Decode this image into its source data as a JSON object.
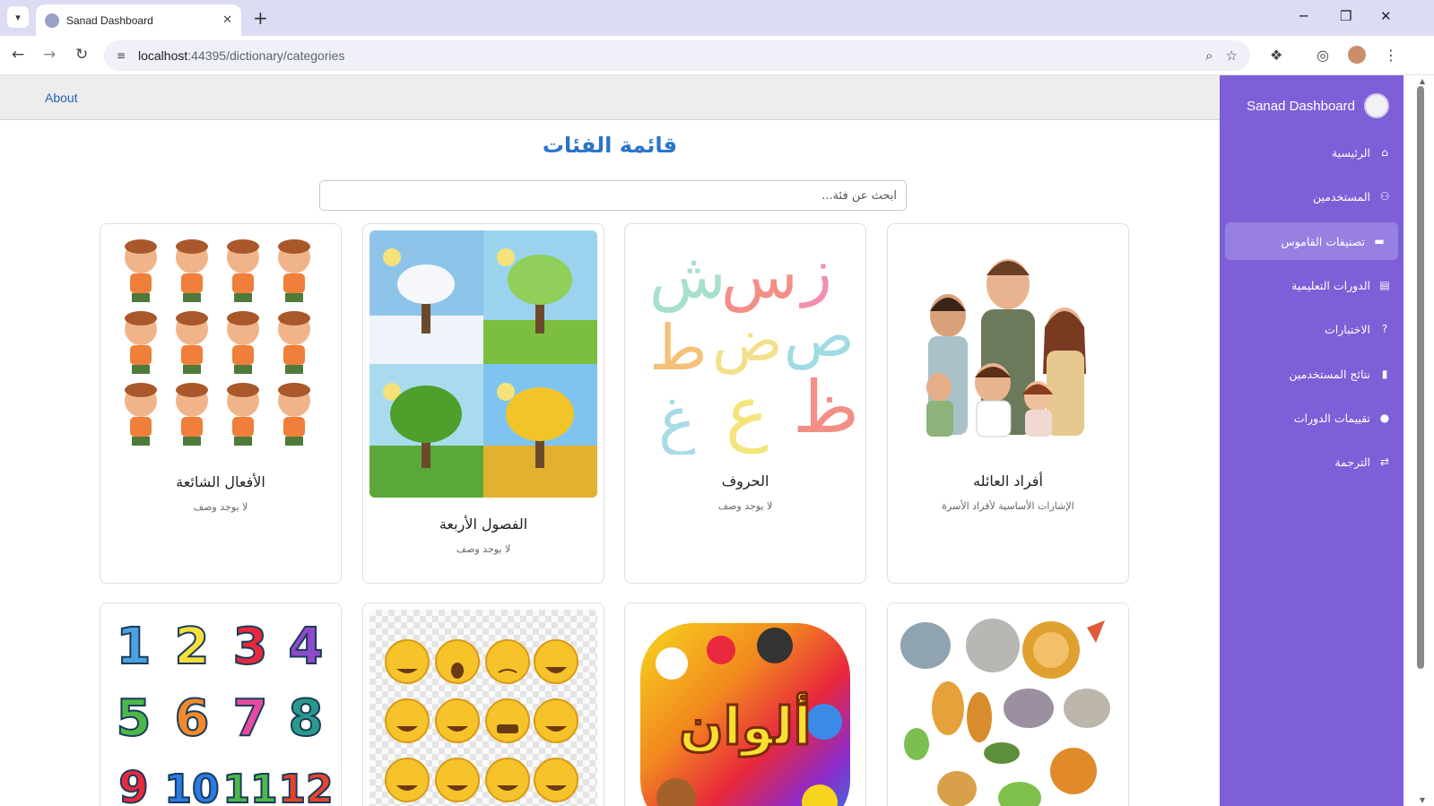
{
  "browser": {
    "tab_title": "Sanad Dashboard",
    "url_host": "localhost",
    "url_rest": ":44395/dictionary/categories",
    "new_tab_symbol": "+",
    "minimize_symbol": "─",
    "restore_symbol": "❐",
    "close_symbol": "✕",
    "tab_close_symbol": "✕",
    "tab_list_symbol": "▾"
  },
  "topnav": {
    "about_label": "About"
  },
  "sidebar": {
    "brand_title": "Sanad Dashboard",
    "items": [
      {
        "label": "الرئيسية",
        "icon": "home-icon",
        "glyph": "⌂"
      },
      {
        "label": "المستخدمين",
        "icon": "users-icon",
        "glyph": "👥"
      },
      {
        "label": "تصنيفات القاموس",
        "icon": "folder-icon",
        "glyph": "▬"
      },
      {
        "label": "الدورات التعليمية",
        "icon": "course-icon",
        "glyph": "▤"
      },
      {
        "label": "الاختبارات",
        "icon": "question-icon",
        "glyph": "?"
      },
      {
        "label": "نتائج المستخدمين",
        "icon": "chart-icon",
        "glyph": "▮"
      },
      {
        "label": "تقييمات الدورات",
        "icon": "comment-icon",
        "glyph": "●"
      },
      {
        "label": "الترجمة",
        "icon": "translate-icon",
        "glyph": "⇄"
      }
    ],
    "active_index": 2
  },
  "main": {
    "title": "قائمة الفئات",
    "search_placeholder": "ابحث عن فئة..."
  },
  "categories": [
    {
      "title": "أفراد العائله",
      "description": "الإشارات الأساسية لأفراد الأسرة",
      "image": "family-illustration"
    },
    {
      "title": "الحروف",
      "description": "لا يوجد وصف",
      "image": "arabic-letters-illustration"
    },
    {
      "title": "الفصول الأربعة",
      "description": "لا يوجد وصف",
      "image": "four-seasons-illustration"
    },
    {
      "title": "الأفعال الشائعة",
      "description": "لا يوجد وصف",
      "image": "common-verbs-illustration"
    },
    {
      "title": "",
      "description": "",
      "image": "animals-illustration"
    },
    {
      "title": "",
      "description": "",
      "image": "colors-illustration",
      "logo_text": "ألوان"
    },
    {
      "title": "",
      "description": "",
      "image": "emotions-illustration"
    },
    {
      "title": "",
      "description": "",
      "image": "numbers-illustration",
      "numbers": [
        "1",
        "2",
        "3",
        "4",
        "5",
        "6",
        "7",
        "8",
        "9",
        "10",
        "11",
        "12"
      ]
    }
  ],
  "colors": {
    "sidebar": "#7d5fd7",
    "sidebar_active": "#9880e2",
    "title_blue": "#2a74c9",
    "link_blue": "#1e64b4"
  }
}
